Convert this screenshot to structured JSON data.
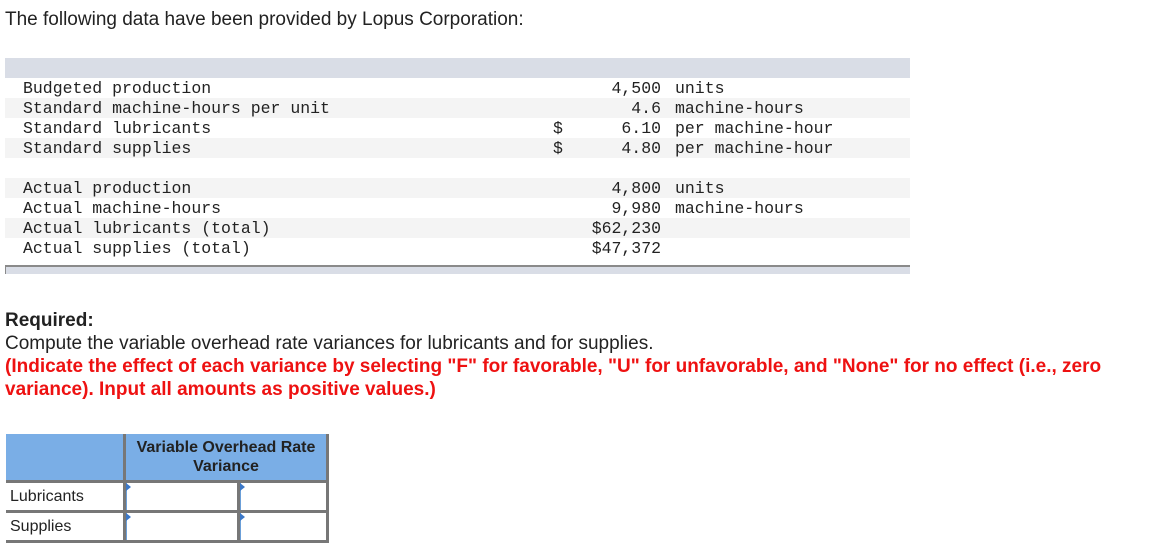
{
  "intro": "The following data have been provided by Lopus Corporation:",
  "data_table": {
    "rows": [
      {
        "label": "Budgeted production",
        "currency": "",
        "value": "4,500",
        "unit": "units"
      },
      {
        "label": "Standard machine-hours per unit",
        "currency": "",
        "value": "4.6",
        "unit": "machine-hours"
      },
      {
        "label": "Standard lubricants",
        "currency": "$",
        "value": "6.10",
        "unit": "per machine-hour"
      },
      {
        "label": "Standard supplies",
        "currency": "$",
        "value": "4.80",
        "unit": "per machine-hour"
      },
      {
        "label": "",
        "currency": "",
        "value": "",
        "unit": ""
      },
      {
        "label": "Actual production",
        "currency": "",
        "value": "4,800",
        "unit": "units"
      },
      {
        "label": "Actual machine-hours",
        "currency": "",
        "value": "9,980",
        "unit": "machine-hours"
      },
      {
        "label": "Actual lubricants (total)",
        "currency": "",
        "value": "$62,230",
        "unit": ""
      },
      {
        "label": "Actual supplies (total)",
        "currency": "",
        "value": "$47,372",
        "unit": ""
      }
    ]
  },
  "required": {
    "title": "Required:",
    "text": "Compute the variable overhead rate variances for lubricants and for supplies.",
    "note": "(Indicate the effect of each variance by selecting \"F\" for favorable, \"U\" for unfavorable, and \"None\" for no effect (i.e., zero variance). Input all amounts as positive values.)"
  },
  "answer_table": {
    "header": "Variable Overhead Rate Variance",
    "rows": [
      {
        "label": "Lubricants",
        "amount": "",
        "effect": ""
      },
      {
        "label": "Supplies",
        "amount": "",
        "effect": ""
      }
    ]
  }
}
